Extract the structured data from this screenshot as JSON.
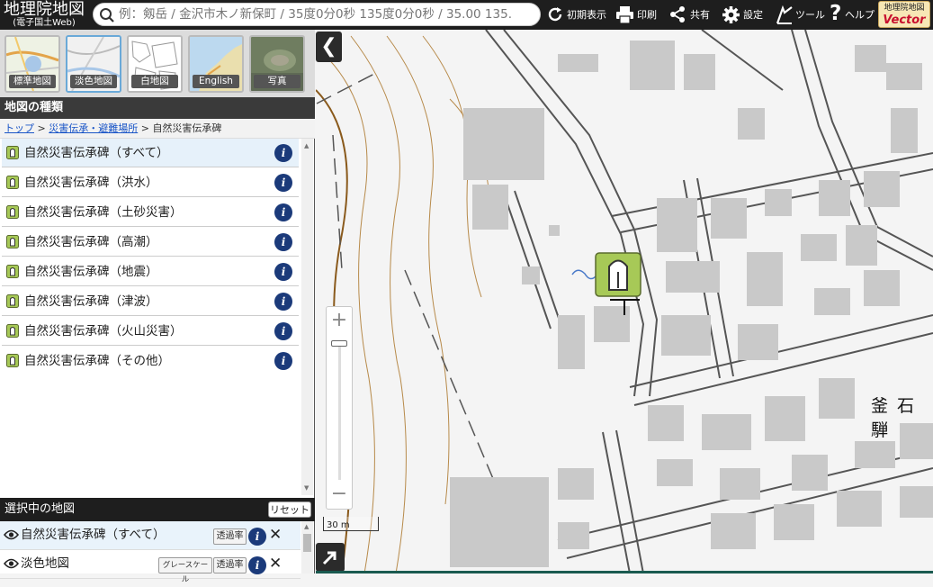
{
  "app": {
    "title_line1": "地理院地図",
    "title_line2": "(電子国土Web)"
  },
  "search": {
    "placeholder": "例：剱岳 / 金沢市木ノ新保町 / 35度0分0秒 135度0分0秒 / 35.00 135."
  },
  "toolbar": {
    "reset_view": "初期表示",
    "print": "印刷",
    "share": "共有",
    "settings": "設定",
    "tools": "ツール",
    "help": "ヘルプ"
  },
  "vector_logo": {
    "line1": "地理院地図",
    "line2": "Vector"
  },
  "basemaps": [
    {
      "label": "標準地図",
      "selected": false
    },
    {
      "label": "淡色地図",
      "selected": true
    },
    {
      "label": "白地図",
      "selected": false
    },
    {
      "label": "English",
      "selected": false
    },
    {
      "label": "写真",
      "selected": false
    }
  ],
  "section_title": "地図の種類",
  "breadcrumb": {
    "top": "トップ",
    "sep1": ">",
    "parent": "災害伝承・避難場所",
    "sep2": ">",
    "current": "自然災害伝承碑"
  },
  "layers": [
    {
      "label": "自然災害伝承碑（すべて）"
    },
    {
      "label": "自然災害伝承碑（洪水）"
    },
    {
      "label": "自然災害伝承碑（土砂災害）"
    },
    {
      "label": "自然災害伝承碑（高潮）"
    },
    {
      "label": "自然災害伝承碑（地震）"
    },
    {
      "label": "自然災害伝承碑（津波）"
    },
    {
      "label": "自然災害伝承碑（火山災害）"
    },
    {
      "label": "自然災害伝承碑（その他）"
    }
  ],
  "info_glyph": "i",
  "selected_maps": {
    "title": "選択中の地図",
    "reset_label": "リセット",
    "rows": [
      {
        "label": "自然災害伝承碑（すべて）",
        "opacity_label": "透過率"
      },
      {
        "label": "淡色地図",
        "grayscale_label": "グレースケール",
        "opacity_label": "透過率"
      }
    ],
    "close_glyph": "✕"
  },
  "map": {
    "collapse_glyph": "❮",
    "zoom_in": "+",
    "zoom_out": "−",
    "scale_label": "30 m",
    "place_label": "釜石騨",
    "colors": {
      "building": "#c9c9c9",
      "road_edge": "#555555",
      "contour": "#b78a4a",
      "marker_green": "#a7c957"
    }
  }
}
